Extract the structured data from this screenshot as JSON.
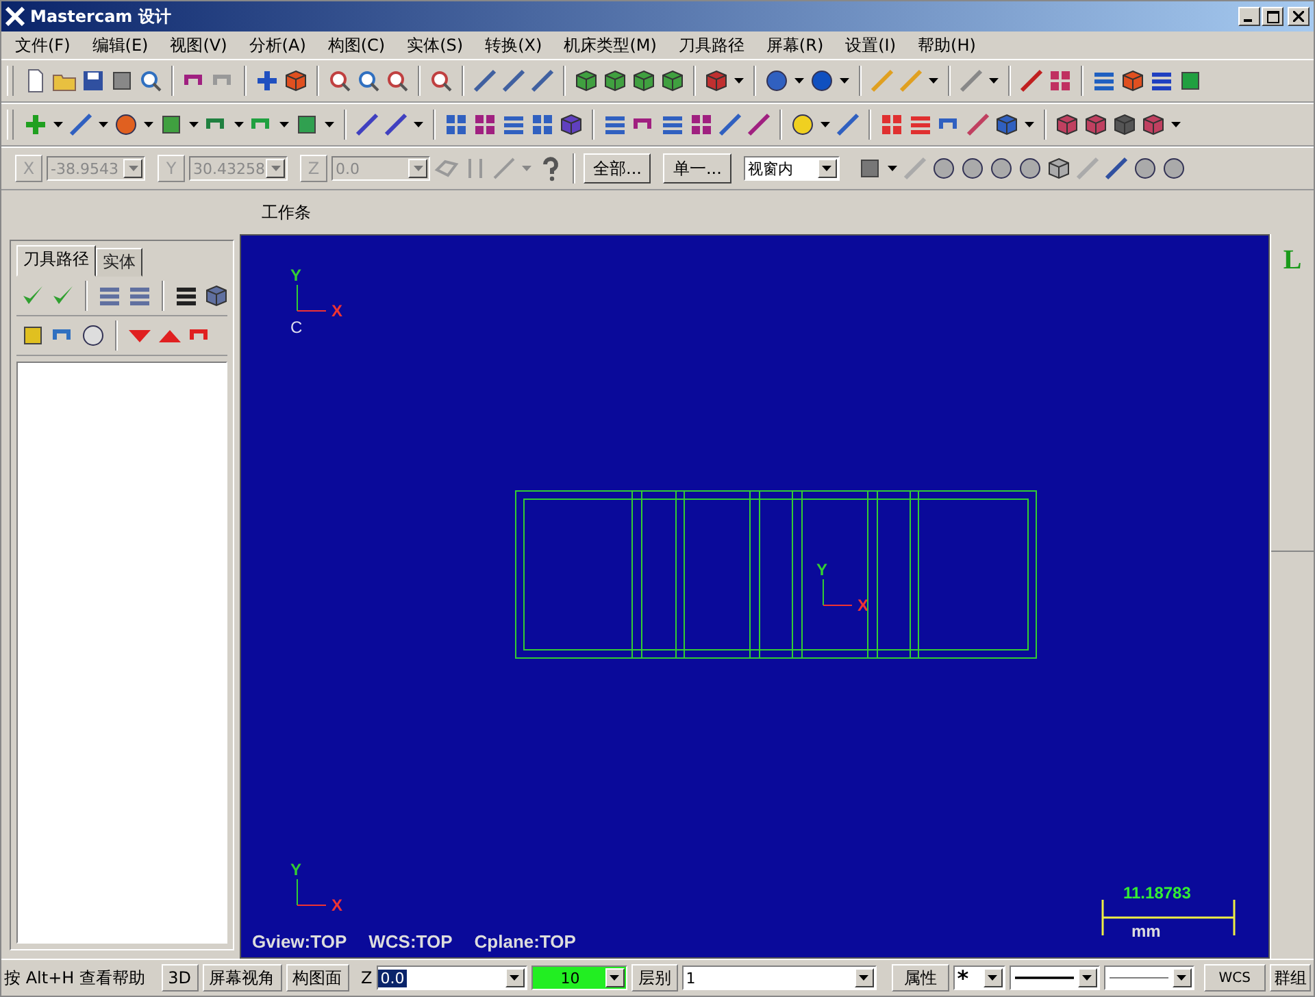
{
  "window": {
    "title": "Mastercam 设计"
  },
  "menu": [
    "文件(F)",
    "编辑(E)",
    "视图(V)",
    "分析(A)",
    "构图(C)",
    "实体(S)",
    "转换(X)",
    "机床类型(M)",
    "刀具路径",
    "屏幕(R)",
    "设置(I)",
    "帮助(H)"
  ],
  "coords": [
    {
      "axis": "X",
      "value": "-38.9543",
      "disabled": true
    },
    {
      "axis": "Y",
      "value": "30.43258",
      "disabled": true
    },
    {
      "axis": "Z",
      "value": "0.0",
      "disabled": true
    }
  ],
  "select_buttons": [
    "全部...",
    "单一..."
  ],
  "select_mode": "视窗内",
  "workbar": {
    "label": "工作条"
  },
  "panel": {
    "tabs": [
      {
        "label": "刀具路径",
        "selected": true
      },
      {
        "label": "实体",
        "selected": false
      }
    ]
  },
  "viewport": {
    "axes": [
      {
        "y": "Y",
        "x": "X",
        "origin": "C"
      },
      {
        "y": "Y",
        "x": "X"
      },
      {
        "y": "Y",
        "x": "X"
      }
    ],
    "view_info": [
      "Gview:TOP",
      "WCS:TOP",
      "Cplane:TOP"
    ],
    "scale": {
      "value": "11.18783",
      "unit": "mm"
    }
  },
  "side_bar": {
    "label": "L"
  },
  "status_bar": {
    "hint": "按 Alt+H 查看帮助",
    "buttons": [
      "3D",
      "屏幕视角",
      "构图面"
    ],
    "z_label": "Z",
    "z_value": "0.0",
    "color_value": "10",
    "layer_label": "层别",
    "layer_value": "1",
    "attributes": "属性",
    "point_style": "*",
    "wcs": "WCS",
    "group": "群组"
  }
}
